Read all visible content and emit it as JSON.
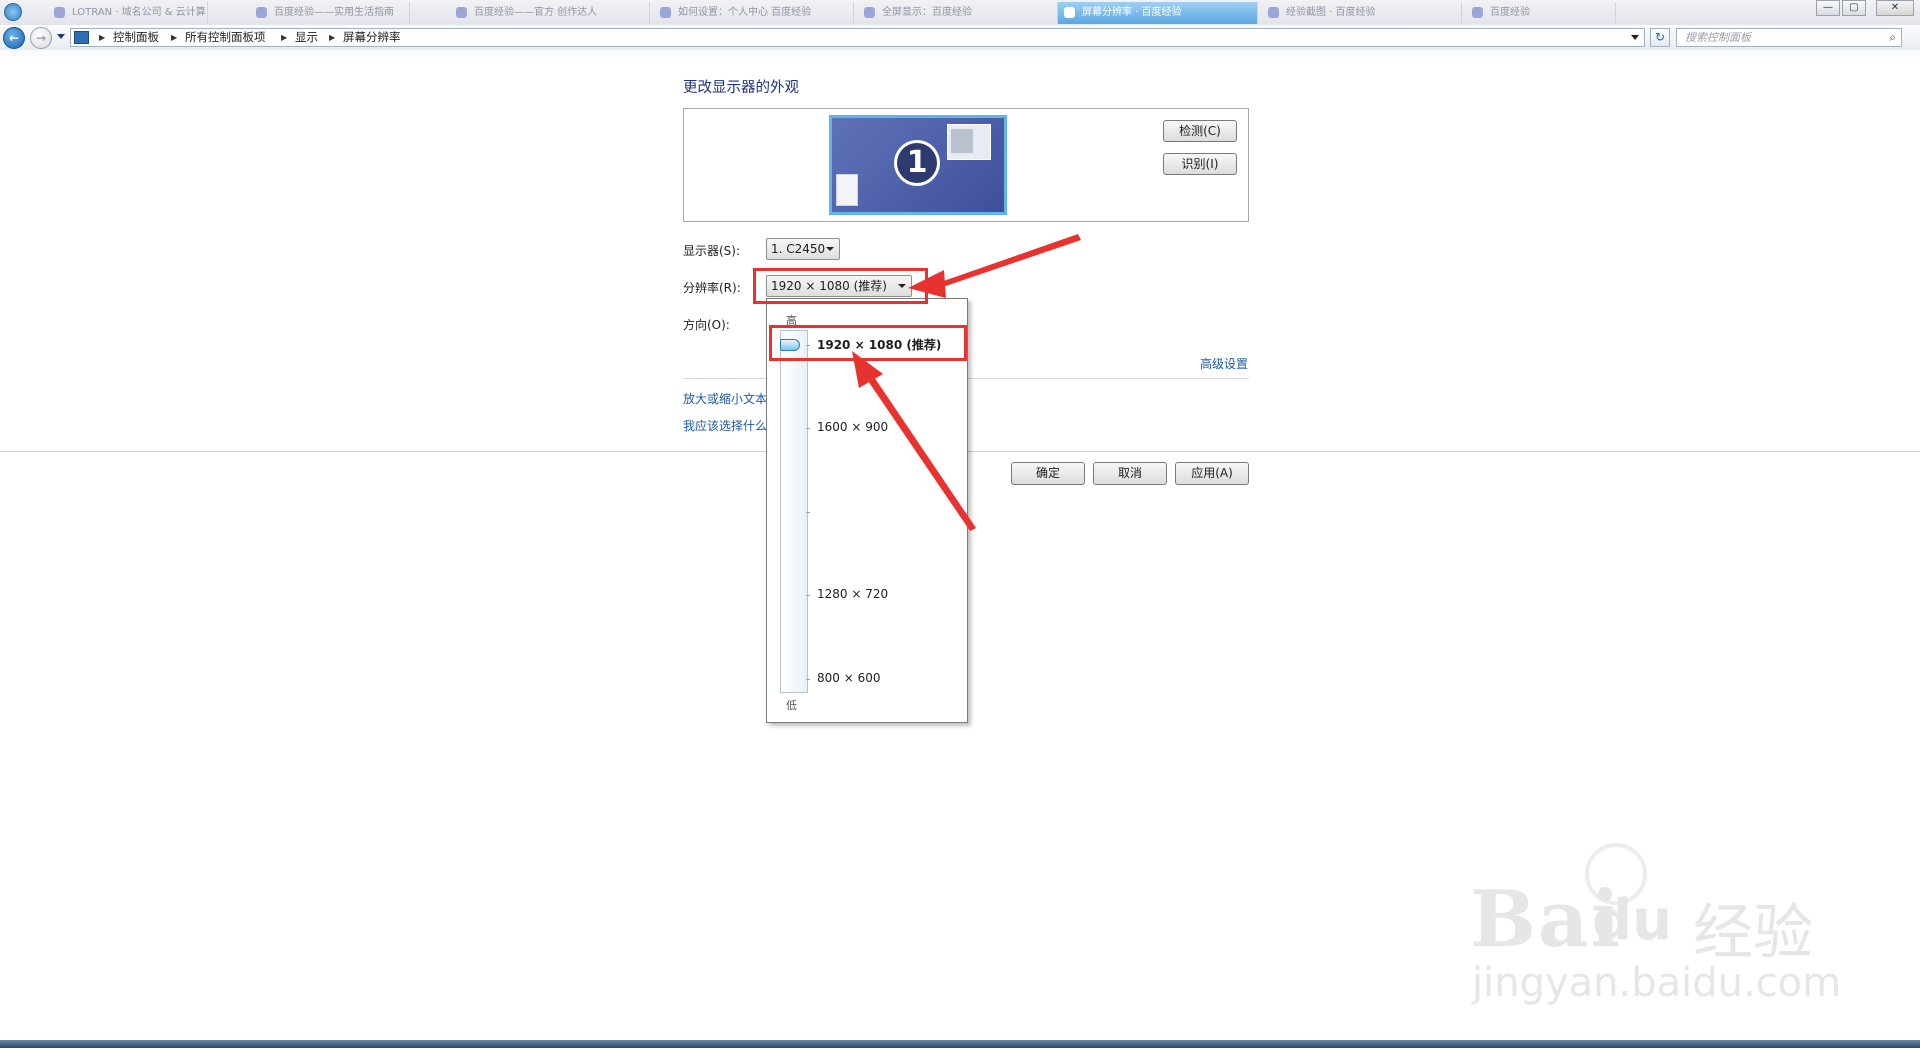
{
  "browser": {
    "tabs": [
      "LOTRAN · 域名公司 & 云计算",
      "百度经验——实用生活指南",
      "百度经验——官方 创作达人",
      "如何设置：个人中心 百度经验",
      "全屏显示：百度经验",
      "屏幕分辨率 · 百度经验",
      "经验截图 · 百度经验",
      "百度经验"
    ],
    "active_tab_index": 5,
    "window_buttons": [
      "—",
      "▢",
      "✕"
    ]
  },
  "nav": {
    "breadcrumb": [
      "控制面板",
      "所有控制面板项",
      "显示",
      "屏幕分辨率"
    ],
    "search_placeholder": "搜索控制面板",
    "back_icon": "back-arrow-icon",
    "forward_icon": "forward-arrow-icon"
  },
  "main": {
    "title": "更改显示器的外观",
    "monitor_number": "1",
    "detect_button": "检测(C)",
    "identify_button": "识别(I)",
    "display_label": "显示器(S):",
    "display_value": "1. C2450",
    "resolution_label": "分辨率(R):",
    "resolution_value": "1920 × 1080 (推荐)",
    "orientation_label": "方向(O):",
    "advanced_link": "高级设置",
    "link_text_size": "放大或缩小文本",
    "link_which_settings": "我应该选择什么",
    "ok_button": "确定",
    "cancel_button": "取消",
    "apply_button": "应用(A)"
  },
  "dropdown": {
    "high_label": "高",
    "low_label": "低",
    "options": [
      "1920 × 1080 (推荐)",
      "1600 × 900",
      "1280 × 720",
      "800 × 600"
    ],
    "selected_index": 0
  },
  "annotation_color": "#e8322f",
  "watermark": {
    "brand": "Bai",
    "brand2": "du",
    "cn": "经验",
    "url": "jingyan.baidu.com"
  }
}
